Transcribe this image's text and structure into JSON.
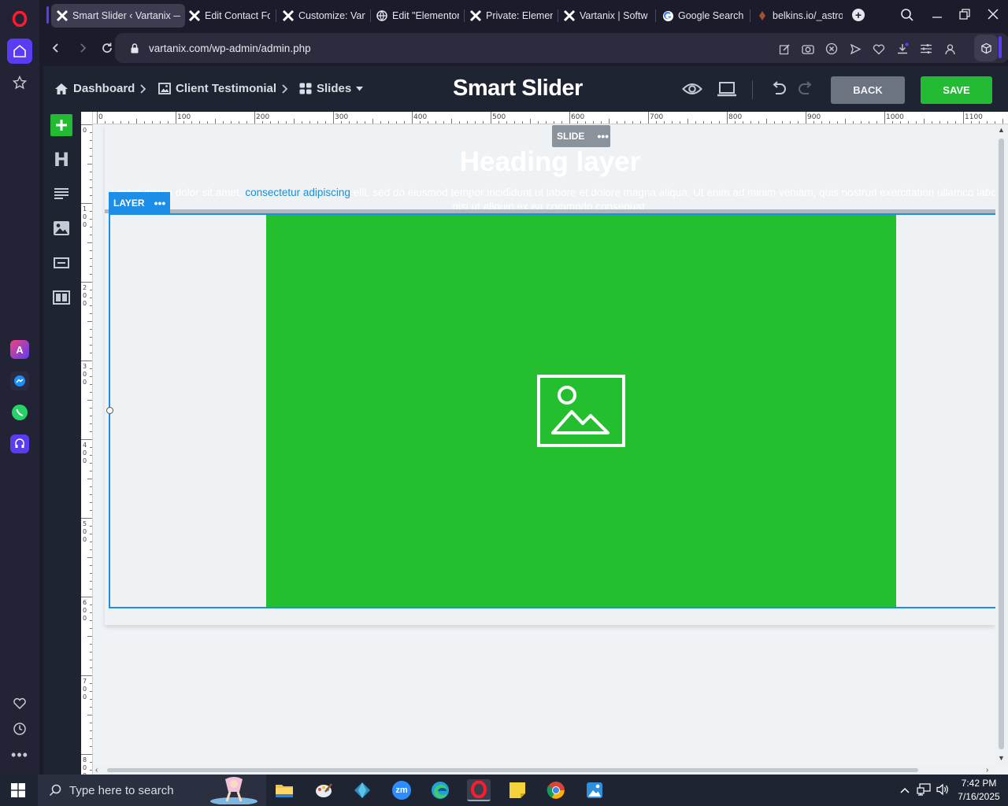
{
  "browser": {
    "tabs": [
      {
        "title": "Smart Slider ‹ Vartanix — WordPress",
        "icon": "vartanix-icon",
        "active": true
      },
      {
        "title": "Edit Contact Form",
        "icon": "vartanix-icon"
      },
      {
        "title": "Customize: Vartanix",
        "icon": "vartanix-icon"
      },
      {
        "title": "Edit \"Elementor Page\"",
        "icon": "globe-icon"
      },
      {
        "title": "Private: Elementor",
        "icon": "vartanix-icon"
      },
      {
        "title": "Vartanix | Software",
        "icon": "vartanix-icon"
      },
      {
        "title": "Google Search",
        "icon": "google-icon"
      },
      {
        "title": "belkins.io/_astro/",
        "icon": "page-icon"
      }
    ],
    "url": "vartanix.com/wp-admin/admin.php"
  },
  "topbar": {
    "breadcrumbs": [
      "Dashboard",
      "Client Testimonial",
      "Slides"
    ],
    "logo": "Smart Slider",
    "back_label": "BACK",
    "save_label": "SAVE"
  },
  "ruler": {
    "h_labels": [
      "0",
      "100",
      "200",
      "300",
      "400",
      "500",
      "600",
      "700",
      "800",
      "900",
      "1000",
      "1100"
    ],
    "v_labels": [
      "0",
      "100",
      "200",
      "300",
      "400",
      "500",
      "600",
      "700",
      "800"
    ]
  },
  "canvas": {
    "slide_badge": "SLIDE",
    "heading": "Heading layer",
    "paragraph_start": "Lorem ipsum dolor sit amet, ",
    "paragraph_link": "consectetur adipiscing",
    "paragraph_end": " elit, sed do eiusmod tempor incididunt ut labore et dolore magna aliqua. Ut enim ad minim veniam, quis nostrud exercitation ullamco laboris",
    "paragraph_line2": "nisi ut aliquip ex ea commodo consequat.",
    "layer_badge": "LAYER"
  },
  "taskbar": {
    "search_placeholder": "Type here to search",
    "time": "7:42 PM",
    "date": "7/16/2025"
  },
  "colors": {
    "accent_green": "#22bb33",
    "layer_blue": "#1c8ee8",
    "image_green": "#23bf2e",
    "opera_red": "#ff1b2d"
  }
}
